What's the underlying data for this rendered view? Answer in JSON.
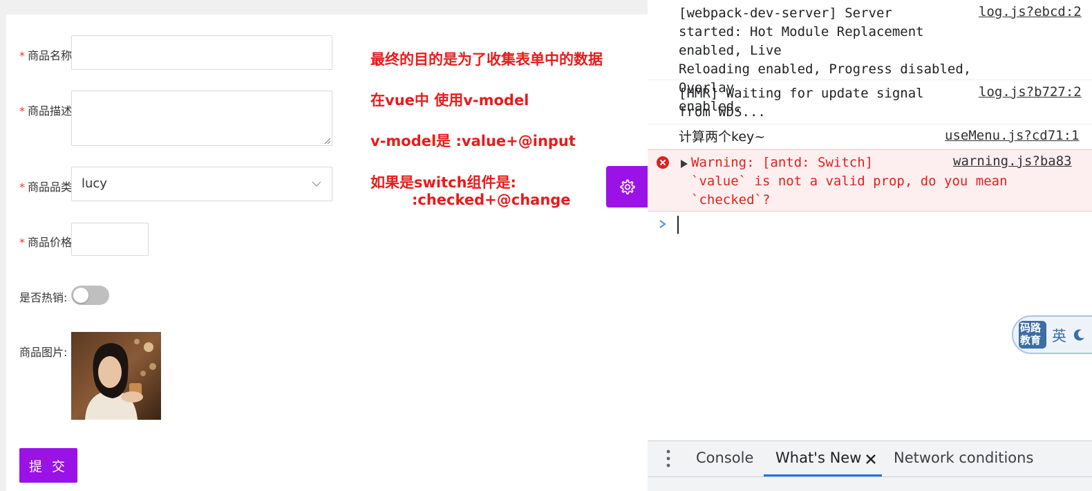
{
  "form": {
    "fields": [
      {
        "label": "商品名称"
      },
      {
        "label": "商品描述"
      },
      {
        "label": "商品品类",
        "value": "lucy"
      },
      {
        "label": "商品价格"
      },
      {
        "label": "是否热销:",
        "toggle_on": false
      },
      {
        "label": "商品图片:"
      }
    ],
    "submit_label": "提 交"
  },
  "notes": [
    "最终的目的是为了收集表单中的数据",
    "在vue中 使用v-model",
    "v-model是 :value+@input",
    "如果是switch组件是:",
    ":checked+@change"
  ],
  "devtools": {
    "logs": [
      {
        "message": "[webpack-dev-server] Server\nstarted: Hot Module Replacement enabled, Live\nReloading enabled, Progress disabled, Overlay\nenabled.",
        "source": "log.js?ebcd:2"
      },
      {
        "message": "[HMR] Waiting for update signal\nfrom WDS...",
        "source": "log.js?b727:2"
      },
      {
        "message": "计算两个key~",
        "source": "useMenu.js?cd71:1"
      }
    ],
    "warning": {
      "message": "Warning: [antd: Switch]\n`value` is not a valid prop, do you mean\n`checked`?",
      "source": "warning.js?ba83"
    },
    "ime_badge": {
      "logo_text": "码路教育",
      "mode": "英"
    },
    "drawer_tabs": [
      "Console",
      "What's New",
      "Network conditions"
    ],
    "active_tab_index": 1,
    "colors": {
      "accent": "#9a12e6",
      "warning_text": "#e0211d",
      "warning_bg": "#fdeff0",
      "active_tab_underline": "#1a73e8"
    }
  }
}
